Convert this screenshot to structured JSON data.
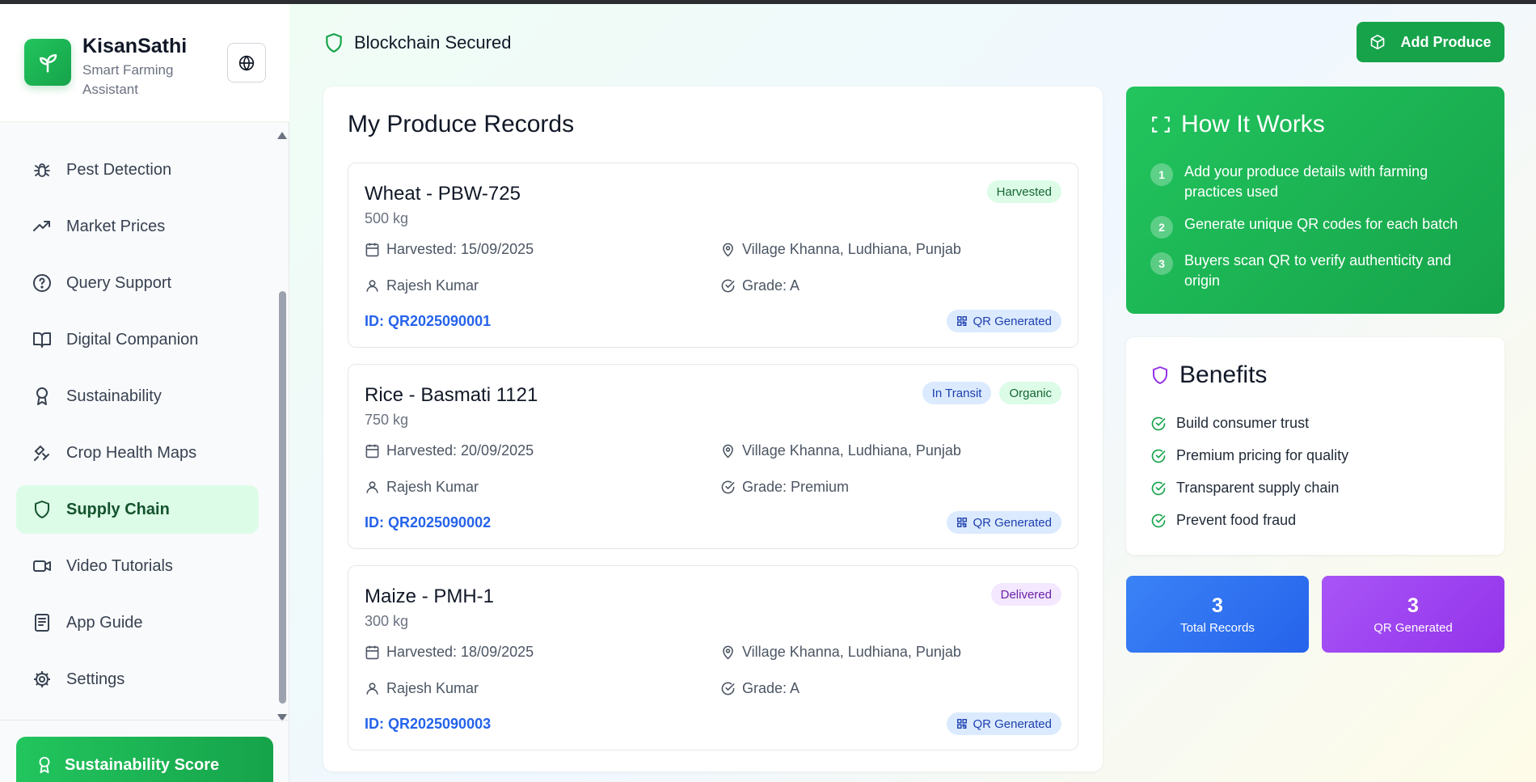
{
  "brand": {
    "title": "KisanSathi",
    "subtitle": "Smart Farming Assistant"
  },
  "nav": {
    "items": [
      {
        "label": "Pest Detection",
        "icon": "bug-icon"
      },
      {
        "label": "Market Prices",
        "icon": "trending-up-icon"
      },
      {
        "label": "Query Support",
        "icon": "help-circle-icon"
      },
      {
        "label": "Digital Companion",
        "icon": "book-icon"
      },
      {
        "label": "Sustainability",
        "icon": "award-icon"
      },
      {
        "label": "Crop Health Maps",
        "icon": "satellite-icon"
      },
      {
        "label": "Supply Chain",
        "icon": "shield-icon",
        "active": true
      },
      {
        "label": "Video Tutorials",
        "icon": "video-icon"
      },
      {
        "label": "App Guide",
        "icon": "document-icon"
      },
      {
        "label": "Settings",
        "icon": "gear-icon"
      }
    ],
    "score_button": "Sustainability Score"
  },
  "header": {
    "secured_label": "Blockchain Secured",
    "add_button": "Add Produce"
  },
  "records": {
    "title": "My Produce Records",
    "items": [
      {
        "name": "Wheat - PBW-725",
        "quantity": "500 kg",
        "harvested": "Harvested: 15/09/2025",
        "location": "Village Khanna, Ludhiana, Punjab",
        "farmer": "Rajesh Kumar",
        "grade": "Grade: A",
        "id": "ID: QR2025090001",
        "badges": [
          "Harvested"
        ],
        "qr": "QR Generated"
      },
      {
        "name": "Rice - Basmati 1121",
        "quantity": "750 kg",
        "harvested": "Harvested: 20/09/2025",
        "location": "Village Khanna, Ludhiana, Punjab",
        "farmer": "Rajesh Kumar",
        "grade": "Grade: Premium",
        "id": "ID: QR2025090002",
        "badges": [
          "In Transit",
          "Organic"
        ],
        "qr": "QR Generated"
      },
      {
        "name": "Maize - PMH-1",
        "quantity": "300 kg",
        "harvested": "Harvested: 18/09/2025",
        "location": "Village Khanna, Ludhiana, Punjab",
        "farmer": "Rajesh Kumar",
        "grade": "Grade: A",
        "id": "ID: QR2025090003",
        "badges": [
          "Delivered"
        ],
        "qr": "QR Generated"
      }
    ]
  },
  "how_it_works": {
    "title": "How It Works",
    "steps": [
      {
        "num": "1",
        "text": "Add your produce details with farming practices used"
      },
      {
        "num": "2",
        "text": "Generate unique QR codes for each batch"
      },
      {
        "num": "3",
        "text": "Buyers scan QR to verify authenticity and origin"
      }
    ]
  },
  "benefits": {
    "title": "Benefits",
    "items": [
      "Build consumer trust",
      "Premium pricing for quality",
      "Transparent supply chain",
      "Prevent food fraud"
    ]
  },
  "stats": [
    {
      "value": "3",
      "label": "Total Records"
    },
    {
      "value": "3",
      "label": "QR Generated"
    }
  ],
  "colors": {
    "brand_green": "#16a34a",
    "link_blue": "#2563eb",
    "stat_blue": "#3b82f6",
    "stat_purple": "#a855f7"
  }
}
